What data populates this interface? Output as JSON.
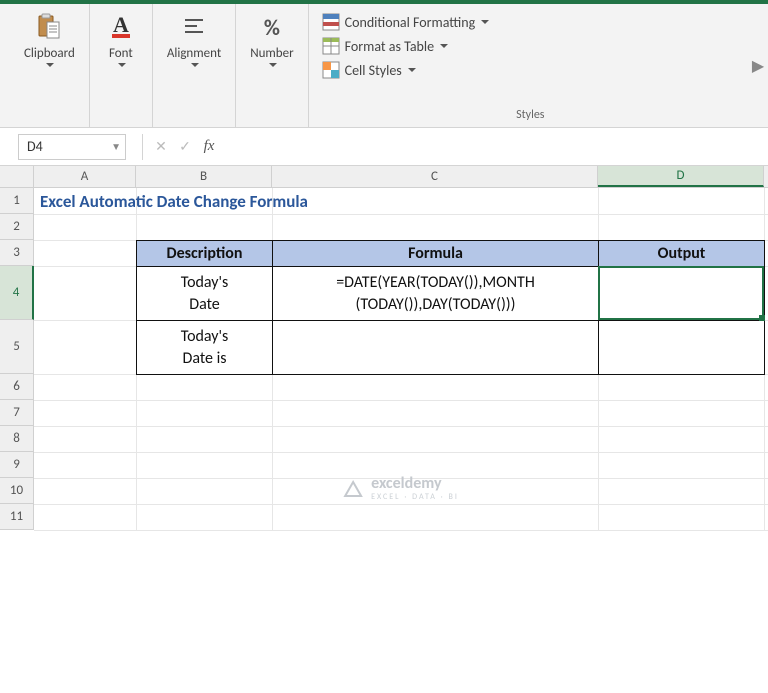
{
  "ribbon": {
    "clipboard_label": "Clipboard",
    "font_label": "Font",
    "alignment_label": "Alignment",
    "number_label": "Number",
    "number_icon": "%",
    "styles_label": "Styles",
    "styles": {
      "conditional_formatting": "Conditional Formatting",
      "format_as_table": "Format as Table",
      "cell_styles": "Cell Styles"
    }
  },
  "formula_bar": {
    "namebox": "D4",
    "formula": ""
  },
  "columns": [
    "A",
    "B",
    "C",
    "D"
  ],
  "rows": [
    "1",
    "2",
    "3",
    "4",
    "5",
    "6",
    "7",
    "8",
    "9",
    "10",
    "11"
  ],
  "colwidths": {
    "A": 102,
    "B": 136,
    "C": 326,
    "D": 166
  },
  "row_heights": {
    "default": 26,
    "tall": 54
  },
  "active_cell": "D4",
  "title": "Excel Automatic Date Change Formula",
  "table": {
    "headers": {
      "b": "Description",
      "c": "Formula",
      "d": "Output"
    },
    "rows": [
      {
        "desc_l1": "Today's",
        "desc_l2": "Date",
        "formula_l1": "=DATE(YEAR(TODAY()),MONTH",
        "formula_l2": "(TODAY()),DAY(TODAY()))",
        "output": ""
      },
      {
        "desc_l1": "Today's",
        "desc_l2": "Date is",
        "formula_l1": "",
        "formula_l2": "",
        "output": ""
      }
    ]
  },
  "watermark": {
    "name": "exceldemy",
    "sub": "EXCEL · DATA · BI"
  }
}
